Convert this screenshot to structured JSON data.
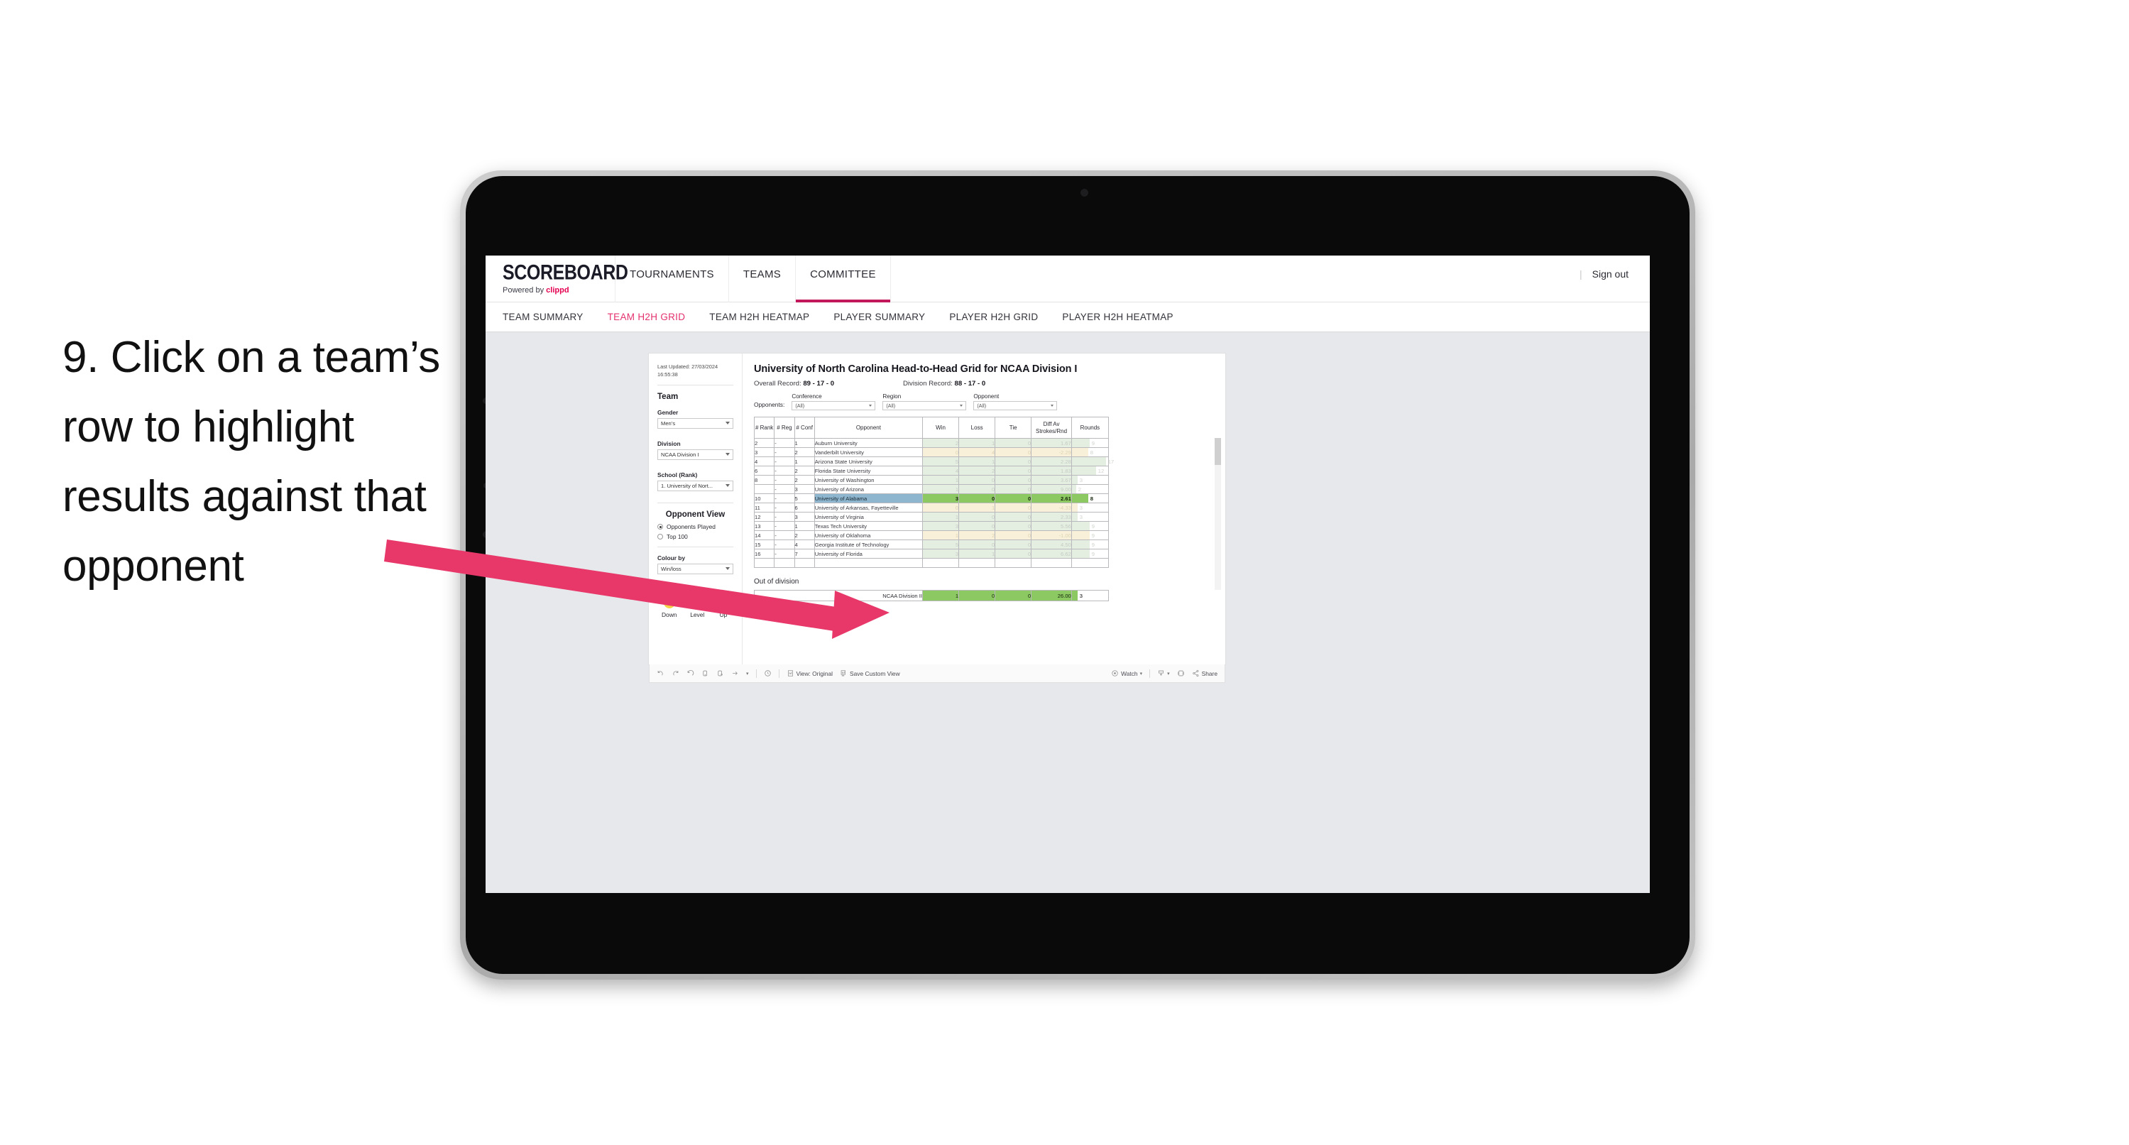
{
  "instruction": {
    "text": "9. Click on a team’s row to highlight results against that opponent"
  },
  "colors": {
    "accent_pink": "#E8386A",
    "brand_red": "#e4004f",
    "active_tab": "#e4326e",
    "highlight_row_name_bg": "#8fb6cf",
    "highlight_row_value_bg": "#8dc963",
    "win_row_bg": "#e4efe1",
    "loss_row_bg": "#f8f0d8",
    "legend_down": "#F5D547",
    "legend_level": "#C9CCD0",
    "legend_up": "#8DC63F"
  },
  "topnav": {
    "brand_title": "SCOREBOARD",
    "brand_sub_prefix": "Powered by ",
    "brand_sub_name": "clippd",
    "items": [
      {
        "label": "TOURNAMENTS",
        "active": false
      },
      {
        "label": "TEAMS",
        "active": false
      },
      {
        "label": "COMMITTEE",
        "active": true
      }
    ],
    "divider": "|",
    "signout": "Sign out"
  },
  "subnav": {
    "items": [
      {
        "label": "TEAM SUMMARY",
        "active": false
      },
      {
        "label": "TEAM H2H GRID",
        "active": true
      },
      {
        "label": "TEAM H2H HEATMAP",
        "active": false
      },
      {
        "label": "PLAYER SUMMARY",
        "active": false
      },
      {
        "label": "PLAYER H2H GRID",
        "active": false
      },
      {
        "label": "PLAYER H2H HEATMAP",
        "active": false
      }
    ]
  },
  "sidebar": {
    "last_updated": "Last Updated: 27/03/2024 16:55:38",
    "team_heading": "Team",
    "gender_label": "Gender",
    "gender_value": "Men’s",
    "division_label": "Division",
    "division_value": "NCAA Division I",
    "school_label": "School (Rank)",
    "school_value": "1. University of Nort...",
    "opponent_view_heading": "Opponent View",
    "opponent_view_options": [
      {
        "label": "Opponents Played",
        "selected": true
      },
      {
        "label": "Top 100",
        "selected": false
      }
    ],
    "colour_by_label": "Colour by",
    "colour_by_value": "Win/loss",
    "legend": [
      {
        "label": "Down",
        "color": "#F5D547"
      },
      {
        "label": "Level",
        "color": "#C9CCD0"
      },
      {
        "label": "Up",
        "color": "#8DC63F"
      }
    ]
  },
  "main": {
    "title": "University of North Carolina Head-to-Head Grid for NCAA Division I",
    "overall_record_label": "Overall Record: ",
    "overall_record_value": "89 - 17 - 0",
    "division_record_label": "Division Record: ",
    "division_record_value": "88 - 17 - 0",
    "opponents_label": "Opponents:",
    "filters": [
      {
        "label": "Conference",
        "value": "(All)"
      },
      {
        "label": "Region",
        "value": "(All)"
      },
      {
        "label": "Opponent",
        "value": "(All)"
      }
    ],
    "out_of_division_heading": "Out of division"
  },
  "chart_data": {
    "type": "table",
    "title": "University of North Carolina Head-to-Head Grid for NCAA Division I",
    "columns": [
      "# Rank",
      "# Reg",
      "# Conf",
      "Opponent",
      "Win",
      "Loss",
      "Tie",
      "Diff Av Strokes/Rnd",
      "Rounds"
    ],
    "rounds_max": 17,
    "rows": [
      {
        "rank": "2",
        "reg": "-",
        "conf": "1",
        "opponent": "Auburn University",
        "win": "2",
        "loss": "1",
        "tie": "0",
        "diff": "1.67",
        "rounds": "9",
        "result": "win",
        "highlighted": false
      },
      {
        "rank": "3",
        "reg": "-",
        "conf": "2",
        "opponent": "Vanderbilt University",
        "win": "0",
        "loss": "4",
        "tie": "0",
        "diff": "-2.29",
        "rounds": "8",
        "result": "loss",
        "highlighted": false
      },
      {
        "rank": "4",
        "reg": "-",
        "conf": "1",
        "opponent": "Arizona State University",
        "win": "5",
        "loss": "1",
        "tie": "0",
        "diff": "2.28",
        "rounds": "17",
        "result": "win",
        "highlighted": false
      },
      {
        "rank": "6",
        "reg": "-",
        "conf": "2",
        "opponent": "Florida State University",
        "win": "4",
        "loss": "2",
        "tie": "0",
        "diff": "1.83",
        "rounds": "12",
        "result": "win",
        "highlighted": false
      },
      {
        "rank": "8",
        "reg": "-",
        "conf": "2",
        "opponent": "University of Washington",
        "win": "1",
        "loss": "0",
        "tie": "0",
        "diff": "3.67",
        "rounds": "3",
        "result": "win",
        "highlighted": false
      },
      {
        "rank": "",
        "reg": "-",
        "conf": "3",
        "opponent": "University of Arizona",
        "win": "1",
        "loss": "0",
        "tie": "0",
        "diff": "9.00",
        "rounds": "2",
        "result": "win",
        "highlighted": false
      },
      {
        "rank": "10",
        "reg": "-",
        "conf": "5",
        "opponent": "University of Alabama",
        "win": "3",
        "loss": "0",
        "tie": "0",
        "diff": "2.61",
        "rounds": "8",
        "result": "win",
        "highlighted": true
      },
      {
        "rank": "11",
        "reg": "-",
        "conf": "6",
        "opponent": "University of Arkansas, Fayetteville",
        "win": "0",
        "loss": "1",
        "tie": "0",
        "diff": "-4.33",
        "rounds": "3",
        "result": "loss",
        "highlighted": false
      },
      {
        "rank": "12",
        "reg": "-",
        "conf": "3",
        "opponent": "University of Virginia",
        "win": "1",
        "loss": "0",
        "tie": "0",
        "diff": "2.33",
        "rounds": "3",
        "result": "win",
        "highlighted": false
      },
      {
        "rank": "13",
        "reg": "-",
        "conf": "1",
        "opponent": "Texas Tech University",
        "win": "3",
        "loss": "0",
        "tie": "0",
        "diff": "5.56",
        "rounds": "9",
        "result": "win",
        "highlighted": false
      },
      {
        "rank": "14",
        "reg": "-",
        "conf": "2",
        "opponent": "University of Oklahoma",
        "win": "1",
        "loss": "2",
        "tie": "0",
        "diff": "-1.00",
        "rounds": "9",
        "result": "loss",
        "highlighted": false
      },
      {
        "rank": "15",
        "reg": "-",
        "conf": "4",
        "opponent": "Georgia Institute of Technology",
        "win": "5",
        "loss": "0",
        "tie": "0",
        "diff": "4.50",
        "rounds": "9",
        "result": "win",
        "highlighted": false
      },
      {
        "rank": "16",
        "reg": "-",
        "conf": "7",
        "opponent": "University of Florida",
        "win": "3",
        "loss": "1",
        "tie": "0",
        "diff": "6.62",
        "rounds": "9",
        "result": "win",
        "highlighted": false
      }
    ],
    "out_of_division": {
      "label": "NCAA Division II",
      "win": "1",
      "loss": "0",
      "tie": "0",
      "diff": "26.00",
      "rounds": "3"
    }
  },
  "toolbar": {
    "view_label": "View: Original",
    "save_label": "Save Custom View",
    "watch_label": "Watch",
    "share_label": "Share"
  }
}
